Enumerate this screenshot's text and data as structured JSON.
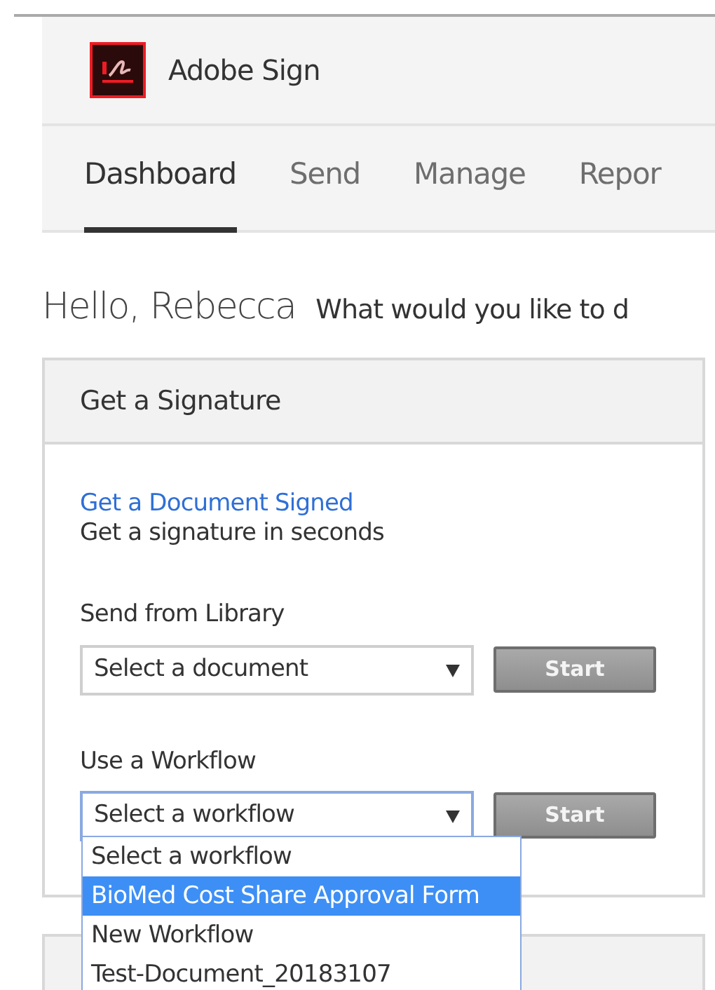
{
  "app": {
    "title": "Adobe Sign"
  },
  "tabs": [
    {
      "label": "Dashboard",
      "selected": true
    },
    {
      "label": "Send",
      "selected": false
    },
    {
      "label": "Manage",
      "selected": false
    },
    {
      "label": "Repor",
      "selected": false
    }
  ],
  "greeting": {
    "name": "Hello, Rebecca",
    "prompt": "What would you like to d"
  },
  "card": {
    "title": "Get a Signature",
    "link": "Get a Document Signed",
    "subtitle": "Get a signature in seconds",
    "sections": [
      {
        "label": "Send from Library",
        "value": "Select a document",
        "button": "Start",
        "focused": false
      },
      {
        "label": "Use a Workflow",
        "value": "Select a workflow",
        "button": "Start",
        "focused": true
      }
    ]
  },
  "dropdown": [
    {
      "label": "Select a workflow",
      "selected": false
    },
    {
      "label": "BioMed Cost Share Approval Form",
      "selected": true
    },
    {
      "label": "New Workflow",
      "selected": false
    },
    {
      "label": "Test-Document_20183107",
      "selected": false
    }
  ]
}
